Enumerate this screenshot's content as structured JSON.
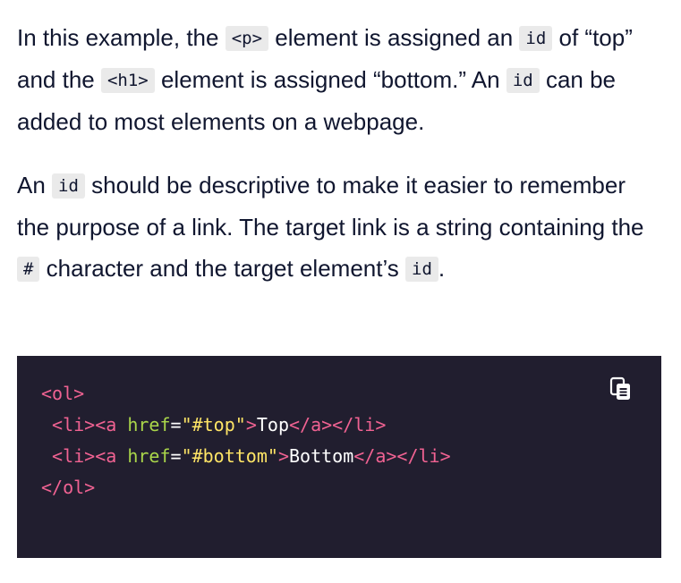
{
  "paragraph_1": {
    "s1": "In this example, the ",
    "c1": "<p>",
    "s2": " element is assigned an ",
    "c2": "id",
    "s3": " of “top” and the ",
    "c3": "<h1>",
    "s4": " element is assigned “bottom.” An ",
    "c4": "id",
    "s5": " can be added to most elements on a webpage."
  },
  "paragraph_2": {
    "s1": "An ",
    "c1": "id",
    "s2": " should be descriptive to make it easier to remember the purpose of a link. The target link is a string containing the ",
    "c2": "#",
    "s3": " character and the target element’s ",
    "c3": "id",
    "s4": "."
  },
  "code_block": {
    "copy_icon": "copy-clipboard-icon",
    "lines": [
      [
        {
          "t": "tag",
          "v": "<ol>"
        }
      ],
      [
        {
          "t": "text",
          "v": " "
        },
        {
          "t": "tag",
          "v": "<li><a "
        },
        {
          "t": "attr",
          "v": "href"
        },
        {
          "t": "eq",
          "v": "="
        },
        {
          "t": "str",
          "v": "\"#top\""
        },
        {
          "t": "tag",
          "v": ">"
        },
        {
          "t": "text",
          "v": "Top"
        },
        {
          "t": "tag",
          "v": "</a></li>"
        }
      ],
      [
        {
          "t": "text",
          "v": " "
        },
        {
          "t": "tag",
          "v": "<li><a "
        },
        {
          "t": "attr",
          "v": "href"
        },
        {
          "t": "eq",
          "v": "="
        },
        {
          "t": "str",
          "v": "\"#bottom\""
        },
        {
          "t": "tag",
          "v": ">"
        },
        {
          "t": "text",
          "v": "Bottom"
        },
        {
          "t": "tag",
          "v": "</a></li>"
        }
      ],
      [
        {
          "t": "tag",
          "v": "</ol>"
        }
      ]
    ]
  },
  "colors": {
    "text": "#10162f",
    "inline_code_bg": "#eaeaea",
    "code_bg": "#211e2f",
    "tag": "#f06292",
    "attr": "#aad64a",
    "string": "#ffe566",
    "plain": "#ffffff"
  }
}
